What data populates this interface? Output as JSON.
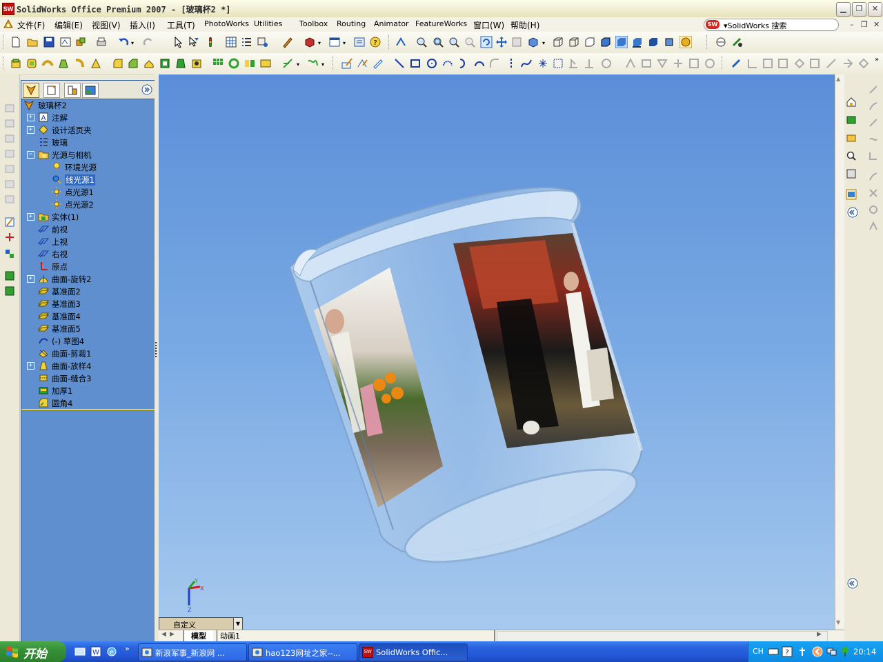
{
  "window": {
    "title": "SolidWorks Office Premium 2007 - [玻璃杯2 *]",
    "logo_text": "SW"
  },
  "menu": {
    "items": [
      "文件(F)",
      "编辑(E)",
      "视图(V)",
      "插入(I)",
      "工具(T)",
      "PhotoWorks",
      "Utilities",
      "Toolbox",
      "Routing",
      "Animator",
      "FeatureWorks",
      "窗口(W)",
      "帮助(H)"
    ]
  },
  "search": {
    "label": "SolidWorks 搜索"
  },
  "tree": {
    "root": "玻璃杯2",
    "items": [
      {
        "label": "注解",
        "icon": "annotation-icon",
        "expander": "+",
        "indent": 0
      },
      {
        "label": "设计活页夹",
        "icon": "design-binder-icon",
        "expander": "+",
        "indent": 0
      },
      {
        "label": "玻璃",
        "icon": "material-icon",
        "expander": "",
        "indent": 0
      },
      {
        "label": "光源与相机",
        "icon": "lights-folder-icon",
        "expander": "-",
        "indent": 0
      },
      {
        "label": "环境光源",
        "icon": "bulb-icon",
        "expander": "",
        "indent": 1
      },
      {
        "label": "线光源1",
        "icon": "directional-light-icon",
        "expander": "",
        "indent": 1,
        "selected": true
      },
      {
        "label": "点光源1",
        "icon": "point-light-icon",
        "expander": "",
        "indent": 1
      },
      {
        "label": "点光源2",
        "icon": "point-light-icon",
        "expander": "",
        "indent": 1
      },
      {
        "label": "实体(1)",
        "icon": "solid-bodies-icon",
        "expander": "+",
        "indent": 0
      },
      {
        "label": "前视",
        "icon": "plane-icon",
        "expander": "",
        "indent": 0
      },
      {
        "label": "上视",
        "icon": "plane-icon",
        "expander": "",
        "indent": 0
      },
      {
        "label": "右视",
        "icon": "plane-icon",
        "expander": "",
        "indent": 0
      },
      {
        "label": "原点",
        "icon": "origin-icon",
        "expander": "",
        "indent": 0
      },
      {
        "label": "曲面-旋转2",
        "icon": "revolve-surface-icon",
        "expander": "+",
        "indent": 0
      },
      {
        "label": "基准面2",
        "icon": "datum-plane-icon",
        "expander": "",
        "indent": 0
      },
      {
        "label": "基准面3",
        "icon": "datum-plane-icon",
        "expander": "",
        "indent": 0
      },
      {
        "label": "基准面4",
        "icon": "datum-plane-icon",
        "expander": "",
        "indent": 0
      },
      {
        "label": "基准面5",
        "icon": "datum-plane-icon",
        "expander": "",
        "indent": 0
      },
      {
        "label": "(-) 草图4",
        "icon": "sketch-icon",
        "expander": "",
        "indent": 0
      },
      {
        "label": "曲面-剪裁1",
        "icon": "trim-surface-icon",
        "expander": "",
        "indent": 0
      },
      {
        "label": "曲面-放样4",
        "icon": "loft-surface-icon",
        "expander": "+",
        "indent": 0
      },
      {
        "label": "曲面-缝合3",
        "icon": "knit-surface-icon",
        "expander": "",
        "indent": 0
      },
      {
        "label": "加厚1",
        "icon": "thicken-icon",
        "expander": "",
        "indent": 0
      },
      {
        "label": "圆角4",
        "icon": "fillet-icon",
        "expander": "",
        "indent": 0
      }
    ]
  },
  "triad": {
    "y": "Y",
    "x": "X",
    "z": "Z"
  },
  "view": {
    "selector": "自定义"
  },
  "bottom_tabs": [
    "模型",
    "动画1"
  ],
  "taskbar": {
    "start": "开始",
    "tasks": [
      {
        "label": "新浪军事_新浪网 ..."
      },
      {
        "label": "hao123网址之家--..."
      },
      {
        "label": "SolidWorks Offic..."
      }
    ],
    "tray_lang": "CH",
    "clock": "20:14"
  },
  "colors": {
    "viewport_top": "#5a8ed8",
    "viewport_bottom": "#a7c9ee",
    "tree_bg": "#5f8fcf",
    "selection": "#3168c0",
    "taskbar": "#2458d8",
    "start_green": "#358f35"
  }
}
